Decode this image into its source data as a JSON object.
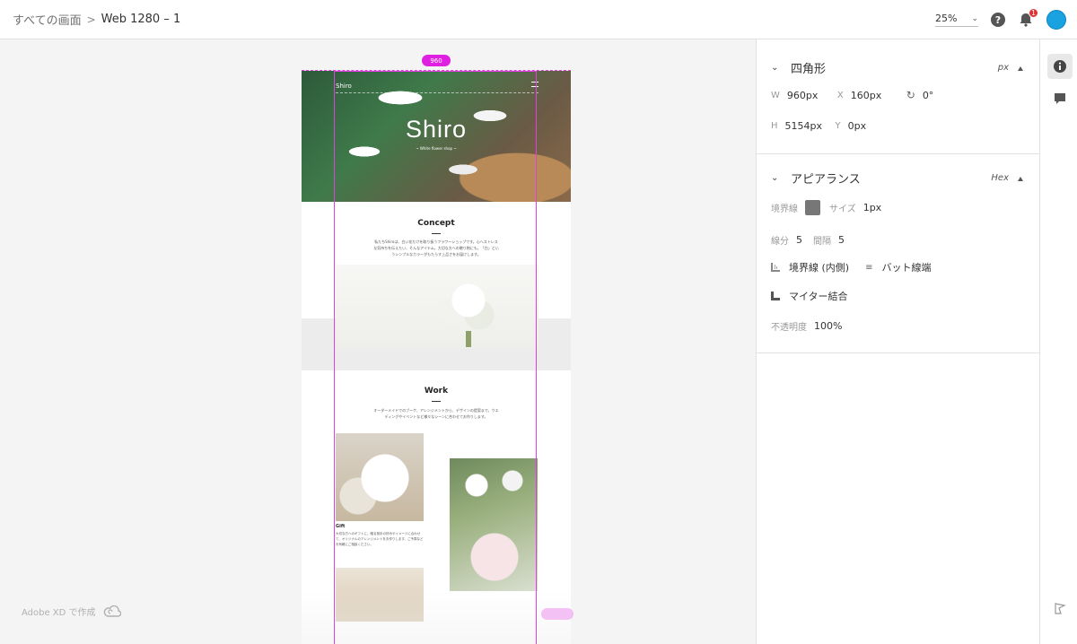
{
  "header": {
    "breadcrumb_root": "すべての画面",
    "breadcrumb_sep": ">",
    "breadcrumb_current": "Web 1280 – 1",
    "zoom": "25%",
    "notification_count": "1"
  },
  "canvas": {
    "width_badge": "960",
    "made_with": "Adobe XD で作成",
    "artboard": {
      "brand": "Shiro",
      "hero_title": "Shiro",
      "hero_sub": "~ White flower shop ~",
      "concept_title": "Concept",
      "concept_text": "私たちShiroは、白い花だけを取り扱うフラワーショップです。心へストレスな気持ちを伝えたい、そんなアイテム。大切な方への贈り物にも。「白」というシンプルなカラーがもたらす上品さをお届けします。",
      "work_title": "Work",
      "work_text": "オーダーメイドでのブーケ、アレンジメントから、デザインの提案まで。ウエディングやイベントなど様々なシーンに合わせてお作りします。",
      "gift_title": "Gift",
      "gift_text": "大切な方へのギフトに。贈る相手の好みやイメージに合わせて、オリジナルのアレンジメントをお作りします。ご予算などお気軽にご相談ください。"
    }
  },
  "panel": {
    "rect": {
      "title": "四角形",
      "unit": "px",
      "w_label": "W",
      "w_value": "960px",
      "x_label": "X",
      "x_value": "160px",
      "rotation_value": "0°",
      "h_label": "H",
      "h_value": "5154px",
      "y_label": "Y",
      "y_value": "0px"
    },
    "appearance": {
      "title": "アピアランス",
      "unit": "Hex",
      "border_label": "境界線",
      "border_color": "#777777",
      "size_label": "サイズ",
      "size_value": "1px",
      "dash_label": "線分",
      "dash_value": "5",
      "gap_label": "間隔",
      "gap_value": "5",
      "stroke_position": "境界線 (内側)",
      "cap": "バット線端",
      "join": "マイター結合",
      "opacity_label": "不透明度",
      "opacity_value": "100%"
    }
  },
  "colors": {
    "selection": "#e040e0",
    "avatar": "#1aa1e0"
  }
}
